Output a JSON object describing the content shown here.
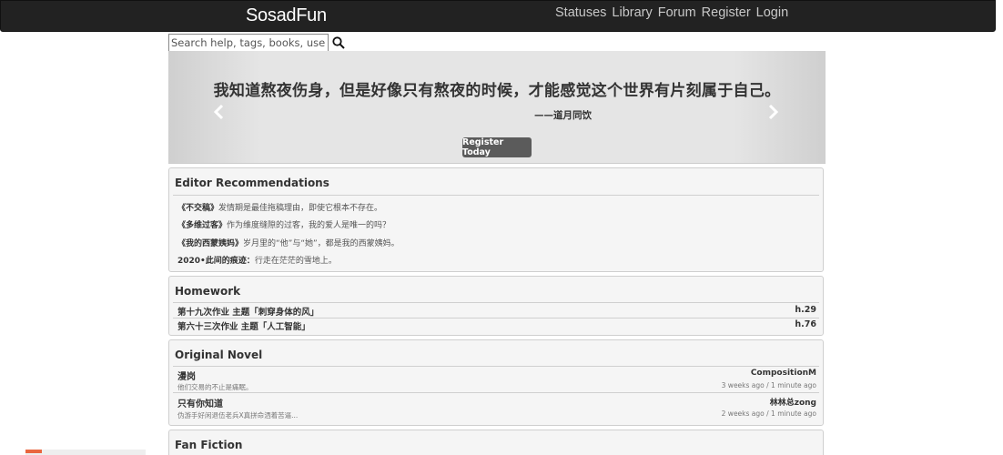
{
  "nav": {
    "brand": "SosadFun",
    "links": [
      "Statuses",
      "Library",
      "Forum",
      "Register",
      "Login"
    ]
  },
  "search": {
    "placeholder": "Search help, tags, books, users..."
  },
  "carousel": {
    "quote": "我知道熬夜伤身，但是好像只有熬夜的时候，才能感觉这个世界有片刻属于自己。",
    "author": "——道月同饮",
    "button": "Register Today"
  },
  "editor": {
    "title": "Editor Recommendations",
    "items": [
      {
        "book": "《不交稿》",
        "desc": "发情期是最佳拖稿理由，即使它根本不存在。"
      },
      {
        "book": "《多维过客》",
        "desc": "作为维度缝隙的过客，我的爱人是唯一的吗？"
      },
      {
        "book": "《我的西蒙姨妈》",
        "desc": "岁月里的“他”与“她”，都是我的西蒙姨妈。"
      },
      {
        "book": "2020•此间的痕迹：",
        "desc": "行走在茫茫的雪地上。"
      }
    ]
  },
  "homework": {
    "title": "Homework",
    "items": [
      {
        "name": "第十九次作业 主题「刺穿身体的风」",
        "tag": "h.29"
      },
      {
        "name": "第六十三次作业 主题「人工智能」",
        "tag": "h.76"
      }
    ]
  },
  "novel": {
    "title": "Original Novel",
    "items": [
      {
        "title": "漫岗",
        "sub": "他们交易的不止是痛眠。",
        "author": "CompositionM",
        "time": "3 weeks ago / 1 minute ago"
      },
      {
        "title": "只有你知道",
        "sub": "伪游手好闲退伍老兵X真拼命洒着苦逼...",
        "author": "林林总zong",
        "time": "2 weeks ago / 1 minute ago"
      }
    ]
  },
  "fanfic": {
    "title": "Fan Fiction"
  }
}
